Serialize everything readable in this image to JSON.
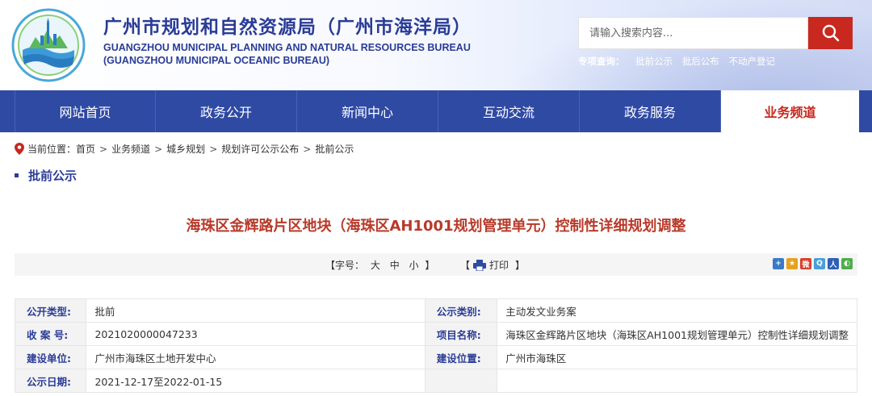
{
  "header": {
    "title": "广州市规划和自然资源局（广州市海洋局）",
    "title_en_1": "GUANGZHOU MUNICIPAL PLANNING AND NATURAL RESOURCES BUREAU",
    "title_en_2": "(GUANGZHOU MUNICIPAL OCEANIC BUREAU)",
    "search_placeholder": "请输入搜索内容...",
    "topic_label": "专项查询：",
    "topic_links": [
      "批前公示",
      "批后公布",
      "不动产登记"
    ]
  },
  "nav": {
    "items": [
      "网站首页",
      "政务公开",
      "新闻中心",
      "互动交流",
      "政务服务",
      "业务频道"
    ],
    "active_index": 5
  },
  "breadcrumb": {
    "prefix": "当前位置：",
    "items": [
      "首页",
      "业务频道",
      "城乡规划",
      "规划许可公示公布",
      "批前公示"
    ],
    "separator": ">"
  },
  "section_title": "批前公示",
  "document": {
    "title": "海珠区金辉路片区地块（海珠区AH1001规划管理单元）控制性详细规划调整"
  },
  "toolbar": {
    "font_label_open": "【字号：",
    "font_options": [
      "大",
      "中",
      "小"
    ],
    "font_label_close": "】",
    "print_open": "【",
    "print_label": "打印",
    "print_close": "】"
  },
  "info_table": {
    "rows": [
      {
        "k1": "公开类型:",
        "v1": "批前",
        "k2": "公示类别:",
        "v2": "主动发文业务案"
      },
      {
        "k1": "收 案 号:",
        "v1": "2021020000047233",
        "k2": "项目名称:",
        "v2": "海珠区金辉路片区地块（海珠区AH1001规划管理单元）控制性详细规划调整"
      },
      {
        "k1": "建设单位:",
        "v1": "广州市海珠区土地开发中心",
        "k2": "建设位置:",
        "v2": "广州市海珠区"
      },
      {
        "k1": "公示日期:",
        "v1": "2021-12-17至2022-01-15",
        "k2": "",
        "v2": ""
      }
    ]
  },
  "colors": {
    "brand_blue": "#2f4aa3",
    "title_blue": "#2a3c96",
    "accent_red": "#c8281e",
    "doc_title_red": "#b83a2a"
  }
}
